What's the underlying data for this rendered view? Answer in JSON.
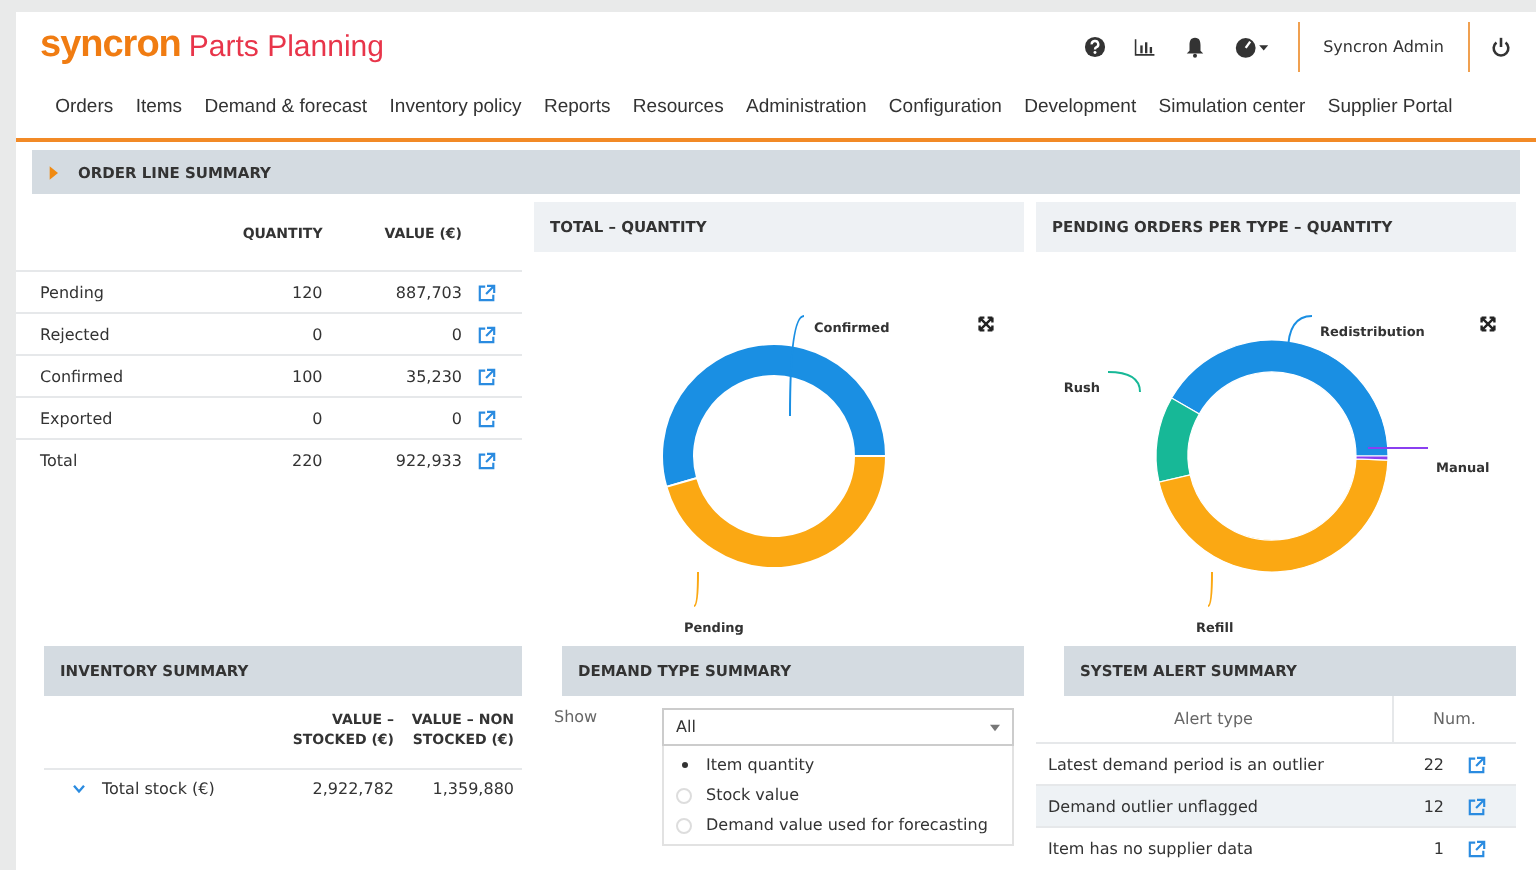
{
  "header": {
    "logo": "syncron",
    "product": "Parts Planning",
    "user": "Syncron Admin"
  },
  "nav": [
    {
      "label": "Orders"
    },
    {
      "label": "Items"
    },
    {
      "label": "Demand & forecast"
    },
    {
      "label": "Inventory policy"
    },
    {
      "label": "Reports"
    },
    {
      "label": "Resources"
    },
    {
      "label": "Administration"
    },
    {
      "label": "Configuration"
    },
    {
      "label": "Development"
    },
    {
      "label": "Simulation center"
    },
    {
      "label": "Supplier Portal"
    }
  ],
  "order_summary": {
    "title": "ORDER LINE SUMMARY",
    "expanded": false,
    "columns": [
      "QUANTITY",
      "VALUE (€)"
    ],
    "rows": [
      {
        "label": "Pending",
        "quantity": "120",
        "value": "887,703"
      },
      {
        "label": "Rejected",
        "quantity": "0",
        "value": "0"
      },
      {
        "label": "Confirmed",
        "quantity": "100",
        "value": "35,230"
      },
      {
        "label": "Exported",
        "quantity": "0",
        "value": "0"
      },
      {
        "label": "Total",
        "quantity": "220",
        "value": "922,933"
      }
    ]
  },
  "total_quantity": {
    "title": "TOTAL – QUANTITY",
    "segments": [
      {
        "label": "Confirmed",
        "color": "#1a8fe3"
      },
      {
        "label": "Pending",
        "color": "#fba813"
      }
    ]
  },
  "pending_per_type": {
    "title": "PENDING ORDERS PER TYPE – QUANTITY",
    "segments": [
      {
        "label": "Redistribution",
        "color": "#1a8fe3"
      },
      {
        "label": "Rush",
        "color": "#17b897"
      },
      {
        "label": "Refill",
        "color": "#fba813"
      },
      {
        "label": "Manual",
        "color": "#8a3ff0"
      }
    ]
  },
  "inventory_summary": {
    "title": "INVENTORY SUMMARY",
    "columns": [
      "VALUE – STOCKED (€)",
      "VALUE – NON STOCKED (€)"
    ],
    "rows": [
      {
        "label": "Total stock (€)",
        "expanded": true,
        "stocked": "2,922,782",
        "non_stocked": "1,359,880"
      }
    ]
  },
  "demand_type": {
    "title": "DEMAND TYPE SUMMARY",
    "show_label": "Show",
    "select_value": "All",
    "options": [
      {
        "label": "Item quantity",
        "selected": true
      },
      {
        "label": "Stock value",
        "selected": false
      },
      {
        "label": "Demand value used for forecasting",
        "selected": false
      }
    ]
  },
  "alerts": {
    "title": "SYSTEM ALERT SUMMARY",
    "columns": [
      "Alert type",
      "Num."
    ],
    "rows": [
      {
        "label": "Latest demand period is an outlier",
        "num": "22",
        "selected": false
      },
      {
        "label": "Demand outlier unflagged",
        "num": "12",
        "selected": true
      },
      {
        "label": "Item has no supplier data",
        "num": "1",
        "selected": false
      }
    ]
  }
}
